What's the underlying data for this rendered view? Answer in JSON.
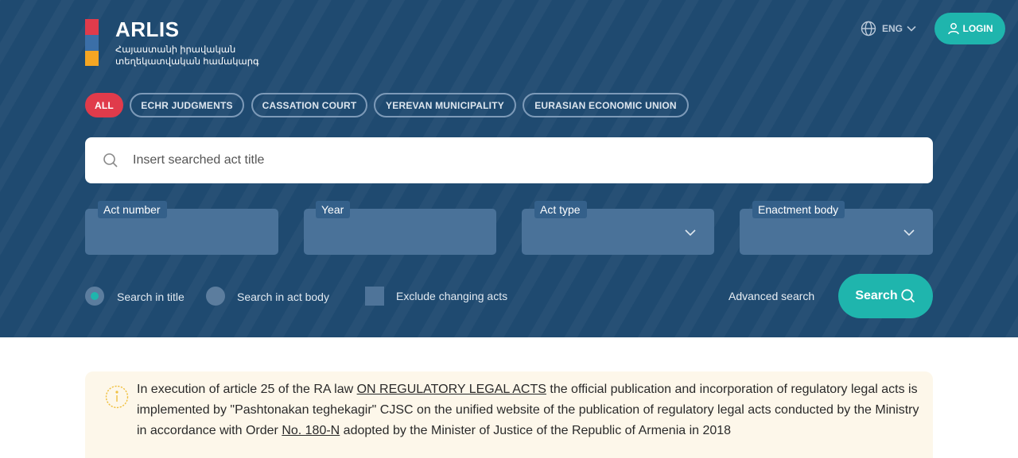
{
  "app": {
    "title": "ARLIS",
    "subtitle_line1": "Հայաստանի իրավական",
    "subtitle_line2": "տեղեկատվական համակարգ"
  },
  "header": {
    "language": "ENG",
    "login_label": "LOGIN",
    "icons": {
      "language": "globe-icon",
      "language_dropdown": "chevron-down-icon",
      "login": "user-icon"
    }
  },
  "filters": [
    {
      "label": "ALL",
      "active": true
    },
    {
      "label": "ECHR JUDGMENTS",
      "active": false
    },
    {
      "label": "CASSATION COURT",
      "active": false
    },
    {
      "label": "YEREVAN MUNICIPALITY",
      "active": false
    },
    {
      "label": "EURASIAN ECONOMIC UNION",
      "active": false
    }
  ],
  "search": {
    "placeholder": "Insert searched act title",
    "value": ""
  },
  "fields": {
    "act_number_label": "Act number",
    "year_label": "Year",
    "act_type_label": "Act type",
    "enactment_body_label": "Enactment body"
  },
  "options": {
    "search_in_title": "Search in title",
    "search_in_body": "Search in act body",
    "exclude_changing": "Exclude changing acts",
    "selected_mode": "title",
    "exclude_checked": false
  },
  "actions": {
    "advanced_search": "Advanced search",
    "search_button": "Search"
  },
  "notice": {
    "part1": "In execution of article 25 of the RA law ",
    "link1": "ON REGULATORY LEGAL ACTS",
    "part2": " the official publication and incorporation of regulatory legal acts is implemented by \"Pashtonakan teghekagir\" CJSC on the unified website of the publication of regulatory legal acts conducted by the Ministry in accordance with Order ",
    "link2": "No. 180-N",
    "part3": " adopted by the Minister of Justice of the Republic of Armenia in 2018"
  },
  "colors": {
    "hero_bg": "#1f4a70",
    "accent_teal": "#1fb5ad",
    "accent_red": "#e03b4b",
    "notice_bg": "#fdf7ea"
  }
}
